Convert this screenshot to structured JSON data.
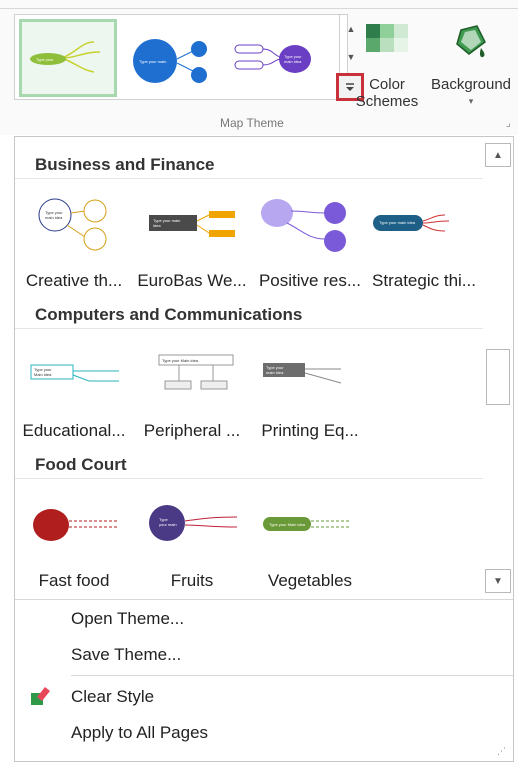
{
  "ribbon": {
    "color_schemes_label": "Color\nSchemes",
    "background_label": "Background",
    "group_label": "Map Theme",
    "gallery_up_icon": "triangle-up-icon",
    "gallery_down_icon": "triangle-down-icon",
    "gallery_more_icon": "more-dropdown-icon",
    "gallery_items": [
      {
        "name": "theme-green",
        "selected": true
      },
      {
        "name": "theme-blue",
        "selected": false
      },
      {
        "name": "theme-purple",
        "selected": false
      }
    ]
  },
  "panel": {
    "categories": [
      {
        "title": "Business and Finance",
        "themes": [
          "Creative th...",
          "EuroBas We...",
          "Positive res...",
          "Strategic thi..."
        ]
      },
      {
        "title": "Computers and Communications",
        "themes": [
          "Educational...",
          "Peripheral ...",
          "Printing Eq..."
        ]
      },
      {
        "title": "Food Court",
        "themes": [
          "Fast food",
          "Fruits",
          "Vegetables"
        ]
      }
    ],
    "menu": {
      "open_theme": "Open Theme...",
      "save_theme": "Save Theme...",
      "clear_style": "Clear Style",
      "apply_all": "Apply to All Pages"
    }
  },
  "colors": {
    "selected_border": "#a8d8b0",
    "highlight_red": "#c8303a",
    "green_theme": "#8fbf3a",
    "blue_theme": "#1f6fd1",
    "purple_theme": "#6a3fc4"
  }
}
